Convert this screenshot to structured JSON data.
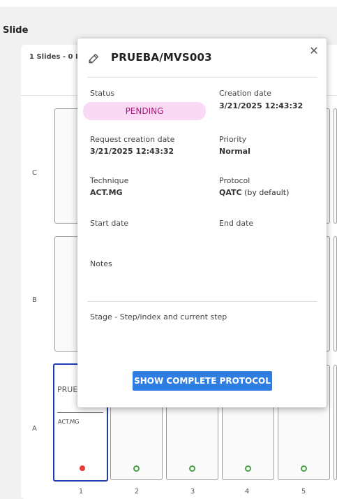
{
  "page": {
    "section_title": "Slide",
    "slides_summary": "1 Slides - 0 I"
  },
  "rows": [
    "C",
    "B",
    "A"
  ],
  "columns": [
    "1",
    "2",
    "3",
    "4",
    "5"
  ],
  "selected_well": {
    "title": "PRUEBA/MVS003",
    "technique": "ACT.MG"
  },
  "modal": {
    "title": "PRUEBA/MVS003",
    "close": "✕",
    "status": {
      "label": "Status",
      "value": "PENDING"
    },
    "creation_date": {
      "label": "Creation date",
      "value": "3/21/2025 12:43:32"
    },
    "request_creation_date": {
      "label": "Request creation date",
      "value": "3/21/2025 12:43:32"
    },
    "priority": {
      "label": "Priority",
      "value": "Normal"
    },
    "technique": {
      "label": "Technique",
      "value": "ACT.MG"
    },
    "protocol": {
      "label": "Protocol",
      "value": "QATC",
      "suffix": " (by default)"
    },
    "start_date": {
      "label": "Start date"
    },
    "end_date": {
      "label": "End date"
    },
    "notes": {
      "label": "Notes"
    },
    "stage": {
      "label": "Stage - Step/index and current step"
    },
    "show_protocol_button": "SHOW COMPLETE PROTOCOL"
  },
  "colors": {
    "accent": "#2f7de1",
    "selected_border": "#1c3bb4",
    "status_pending_bg": "#f9d9f4",
    "status_pending_text": "#b0157a",
    "dot_red": "#e53935",
    "dot_green": "#43a047"
  },
  "icons": {
    "title_icon": "pencil-icon",
    "close_icon": "close-icon"
  }
}
